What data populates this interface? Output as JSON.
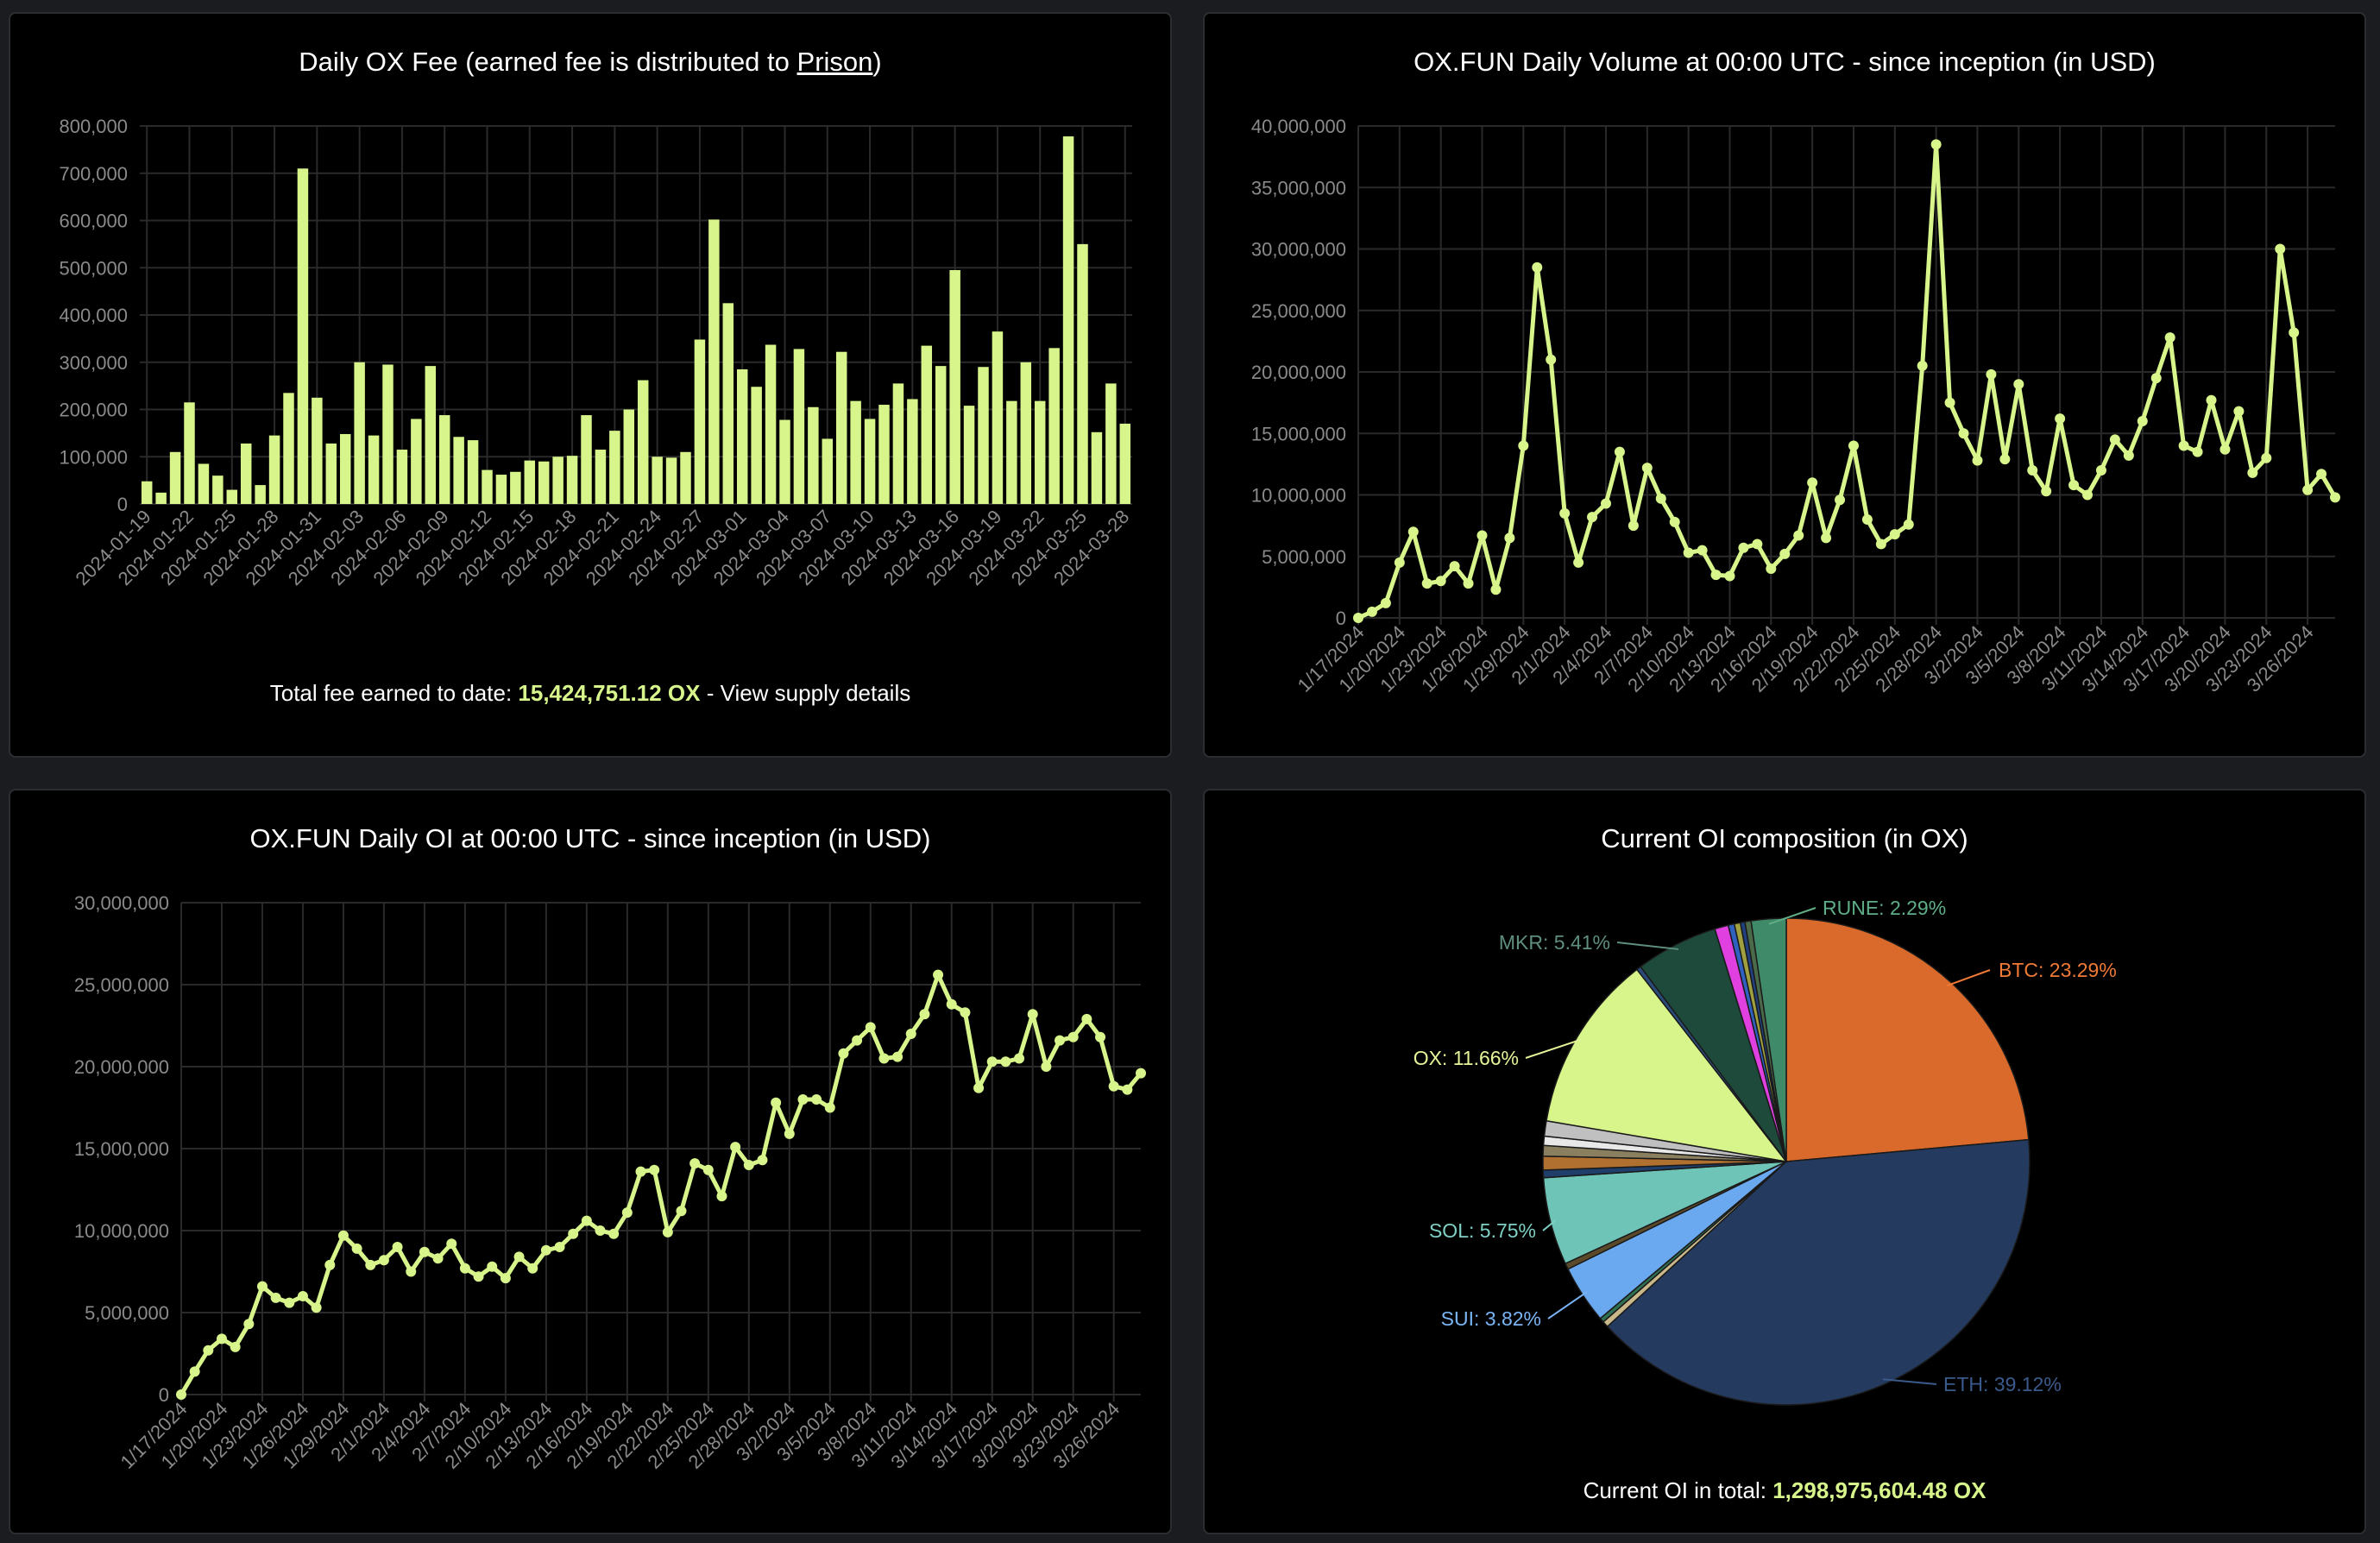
{
  "colors": {
    "accent": "#d7f58a",
    "panel_bg": "#000000",
    "page_bg": "#1b1c1f",
    "grid": "#2a2a2a",
    "axis_text": "#8a8a8a"
  },
  "fee_chart": {
    "title_prefix": "Daily OX Fee (earned fee is distributed to ",
    "title_link": "Prison",
    "title_suffix": ")",
    "footer_label": "Total fee earned to date: ",
    "footer_value": "15,424,751.12 OX",
    "footer_sep": " - ",
    "footer_link": "View supply details"
  },
  "volume_chart": {
    "title": "OX.FUN Daily Volume at 00:00 UTC - since inception (in USD)"
  },
  "oi_chart": {
    "title": "OX.FUN Daily OI at 00:00 UTC - since inception (in USD)"
  },
  "composition_chart": {
    "title": "Current OI composition (in OX)",
    "footer_label": "Current OI in total: ",
    "footer_value": "1,298,975,604.48 OX"
  },
  "chart_data": [
    {
      "type": "bar",
      "title": "Daily OX Fee (earned fee is distributed to Prison)",
      "ylim": [
        0,
        800000
      ],
      "yticks": [
        0,
        100000,
        200000,
        300000,
        400000,
        500000,
        600000,
        700000,
        800000
      ],
      "ytick_labels": [
        "0",
        "100,000",
        "200,000",
        "300,000",
        "400,000",
        "500,000",
        "600,000",
        "700,000",
        "800,000"
      ],
      "xtick_labels": [
        "2024-01-19",
        "2024-01-22",
        "2024-01-25",
        "2024-01-28",
        "2024-01-31",
        "2024-02-03",
        "2024-02-06",
        "2024-02-09",
        "2024-02-12",
        "2024-02-15",
        "2024-02-18",
        "2024-02-21",
        "2024-02-24",
        "2024-02-27",
        "2024-03-01",
        "2024-03-04",
        "2024-03-07",
        "2024-03-10",
        "2024-03-13",
        "2024-03-16",
        "2024-03-19",
        "2024-03-22",
        "2024-03-25",
        "2024-03-28"
      ],
      "values": [
        48000,
        24000,
        110000,
        215000,
        85000,
        60000,
        30000,
        128000,
        40000,
        145000,
        235000,
        710000,
        225000,
        128000,
        148000,
        300000,
        145000,
        295000,
        115000,
        180000,
        292000,
        188000,
        142000,
        135000,
        72000,
        62000,
        68000,
        92000,
        90000,
        100000,
        102000,
        188000,
        115000,
        155000,
        200000,
        262000,
        100000,
        98000,
        110000,
        348000,
        602000,
        425000,
        285000,
        248000,
        337000,
        178000,
        328000,
        205000,
        138000,
        322000,
        218000,
        180000,
        210000,
        255000,
        222000,
        335000,
        292000,
        495000,
        208000,
        290000,
        365000,
        218000,
        300000,
        218000,
        330000,
        778000,
        550000,
        152000,
        255000,
        170000
      ],
      "grid": true
    },
    {
      "type": "line",
      "title": "OX.FUN Daily Volume at 00:00 UTC - since inception (in USD)",
      "ylim": [
        0,
        40000000
      ],
      "yticks": [
        0,
        5000000,
        10000000,
        15000000,
        20000000,
        25000000,
        30000000,
        35000000,
        40000000
      ],
      "ytick_labels": [
        "0",
        "5,000,000",
        "10,000,000",
        "15,000,000",
        "20,000,000",
        "25,000,000",
        "30,000,000",
        "35,000,000",
        "40,000,000"
      ],
      "xtick_labels": [
        "1/17/2024",
        "1/20/2024",
        "1/23/2024",
        "1/26/2024",
        "1/29/2024",
        "2/1/2024",
        "2/4/2024",
        "2/7/2024",
        "2/10/2024",
        "2/13/2024",
        "2/16/2024",
        "2/19/2024",
        "2/22/2024",
        "2/25/2024",
        "2/28/2024",
        "3/2/2024",
        "3/5/2024",
        "3/8/2024",
        "3/11/2024",
        "3/14/2024",
        "3/17/2024",
        "3/20/2024",
        "3/23/2024",
        "3/26/2024"
      ],
      "values": [
        0,
        500000,
        1200000,
        4500000,
        7000000,
        2800000,
        3000000,
        4200000,
        2800000,
        6700000,
        2300000,
        6500000,
        14000000,
        28500000,
        21000000,
        8500000,
        4500000,
        8200000,
        9300000,
        13500000,
        7500000,
        12200000,
        9700000,
        7800000,
        5300000,
        5500000,
        3500000,
        3400000,
        5700000,
        6000000,
        4000000,
        5200000,
        6700000,
        11000000,
        6500000,
        9600000,
        14000000,
        8000000,
        6000000,
        6800000,
        7600000,
        20500000,
        38500000,
        17500000,
        15000000,
        12800000,
        19800000,
        12900000,
        19000000,
        12000000,
        10300000,
        16200000,
        10800000,
        10000000,
        12000000,
        14500000,
        13200000,
        16000000,
        19500000,
        22800000,
        14000000,
        13500000,
        17700000,
        13700000,
        16800000,
        11800000,
        13000000,
        30000000,
        23200000,
        10400000,
        11700000,
        9800000
      ],
      "grid": true
    },
    {
      "type": "line",
      "title": "OX.FUN Daily OI at 00:00 UTC - since inception (in USD)",
      "ylim": [
        0,
        30000000
      ],
      "yticks": [
        0,
        5000000,
        10000000,
        15000000,
        20000000,
        25000000,
        30000000
      ],
      "ytick_labels": [
        "0",
        "5,000,000",
        "10,000,000",
        "15,000,000",
        "20,000,000",
        "25,000,000",
        "30,000,000"
      ],
      "xtick_labels": [
        "1/17/2024",
        "1/20/2024",
        "1/23/2024",
        "1/26/2024",
        "1/29/2024",
        "2/1/2024",
        "2/4/2024",
        "2/7/2024",
        "2/10/2024",
        "2/13/2024",
        "2/16/2024",
        "2/19/2024",
        "2/22/2024",
        "2/25/2024",
        "2/28/2024",
        "3/2/2024",
        "3/5/2024",
        "3/8/2024",
        "3/11/2024",
        "3/14/2024",
        "3/17/2024",
        "3/20/2024",
        "3/23/2024",
        "3/26/2024"
      ],
      "values": [
        0,
        1400000,
        2700000,
        3400000,
        2900000,
        4300000,
        6600000,
        5900000,
        5600000,
        6000000,
        5300000,
        7900000,
        9700000,
        8900000,
        7900000,
        8200000,
        9000000,
        7500000,
        8700000,
        8300000,
        9200000,
        7700000,
        7200000,
        7800000,
        7100000,
        8400000,
        7700000,
        8800000,
        9000000,
        9800000,
        10600000,
        10000000,
        9800000,
        11100000,
        13600000,
        13700000,
        9900000,
        11200000,
        14100000,
        13700000,
        12100000,
        15100000,
        14000000,
        14300000,
        17800000,
        15900000,
        18000000,
        18000000,
        17500000,
        20800000,
        21600000,
        22400000,
        20500000,
        20600000,
        22000000,
        23200000,
        25600000,
        23800000,
        23300000,
        18700000,
        20300000,
        20300000,
        20500000,
        23200000,
        20000000,
        21600000,
        21800000,
        22900000,
        21800000,
        18800000,
        18600000,
        19600000
      ],
      "grid": true
    },
    {
      "type": "pie",
      "title": "Current OI composition (in OX)",
      "labels": [
        "BTC",
        "ETH",
        "SUI",
        "SOL",
        "OX",
        "MKR",
        "RUNE"
      ],
      "label_texts": [
        "BTC: 23.29%",
        "ETH: 39.12%",
        "SUI: 3.82%",
        "SOL: 5.75%",
        "OX: 11.66%",
        "MKR: 5.41%",
        "RUNE: 2.29%"
      ],
      "slices": [
        {
          "label": "BTC",
          "value": 23.29,
          "color": "#d96a2b"
        },
        {
          "label": "ETH",
          "value": 39.12,
          "color": "#243a5e"
        },
        {
          "label": "other-1",
          "value": 0.4,
          "color": "#c8b88a"
        },
        {
          "label": "other-2",
          "value": 0.3,
          "color": "#2f6f52"
        },
        {
          "label": "SUI",
          "value": 3.82,
          "color": "#6aa8f0"
        },
        {
          "label": "other-3",
          "value": 0.4,
          "color": "#5a4a2a"
        },
        {
          "label": "SOL",
          "value": 5.75,
          "color": "#6fc4b8"
        },
        {
          "label": "other-4",
          "value": 0.5,
          "color": "#1f3f6a"
        },
        {
          "label": "other-5",
          "value": 0.9,
          "color": "#b07030"
        },
        {
          "label": "other-6",
          "value": 0.7,
          "color": "#8a8060"
        },
        {
          "label": "other-7",
          "value": 0.6,
          "color": "#e8e8e8"
        },
        {
          "label": "other-8",
          "value": 1.0,
          "color": "#c0c0c0"
        },
        {
          "label": "OX",
          "value": 11.66,
          "color": "#d7f58a"
        },
        {
          "label": "other-9",
          "value": 0.3,
          "color": "#2a4a7a"
        },
        {
          "label": "MKR",
          "value": 5.41,
          "color": "#1d4a3a"
        },
        {
          "label": "other-10",
          "value": 0.9,
          "color": "#e040e0"
        },
        {
          "label": "other-11",
          "value": 0.4,
          "color": "#3060c0"
        },
        {
          "label": "other-12",
          "value": 0.4,
          "color": "#a0a040"
        },
        {
          "label": "other-13",
          "value": 0.3,
          "color": "#204080"
        },
        {
          "label": "other-14",
          "value": 0.4,
          "color": "#4a6a4a"
        },
        {
          "label": "RUNE",
          "value": 2.29,
          "color": "#3f8a68"
        }
      ]
    }
  ]
}
